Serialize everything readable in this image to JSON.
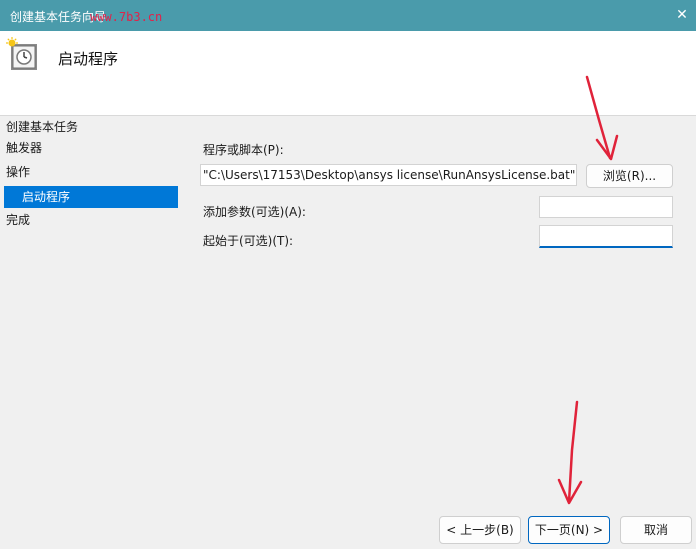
{
  "window": {
    "title": "创建基本任务向导",
    "watermark": "www.7b3.cn",
    "close_glyph": "✕"
  },
  "header": {
    "heading": "启动程序",
    "icon": "clock-task-icon"
  },
  "sidebar": {
    "items": [
      {
        "label": "创建基本任务",
        "active": false
      },
      {
        "label": "触发器",
        "active": false
      },
      {
        "label": "操作",
        "active": false
      },
      {
        "label": "启动程序",
        "active": true
      },
      {
        "label": "完成",
        "active": false
      }
    ]
  },
  "form": {
    "program_label": "程序或脚本(P):",
    "program_value": "\"C:\\Users\\17153\\Desktop\\ansys license\\RunAnsysLicense.bat\"",
    "browse_label": "浏览(R)...",
    "args_label": "添加参数(可选)(A):",
    "args_value": "",
    "startin_label": "起始于(可选)(T):",
    "startin_value": ""
  },
  "footer": {
    "back_label": "< 上一步(B)",
    "next_label": "下一页(N) >",
    "cancel_label": "取消"
  },
  "colors": {
    "titlebar": "#4a9bab",
    "selection": "#0078d7",
    "annotation_arrow": "#e0233a"
  }
}
